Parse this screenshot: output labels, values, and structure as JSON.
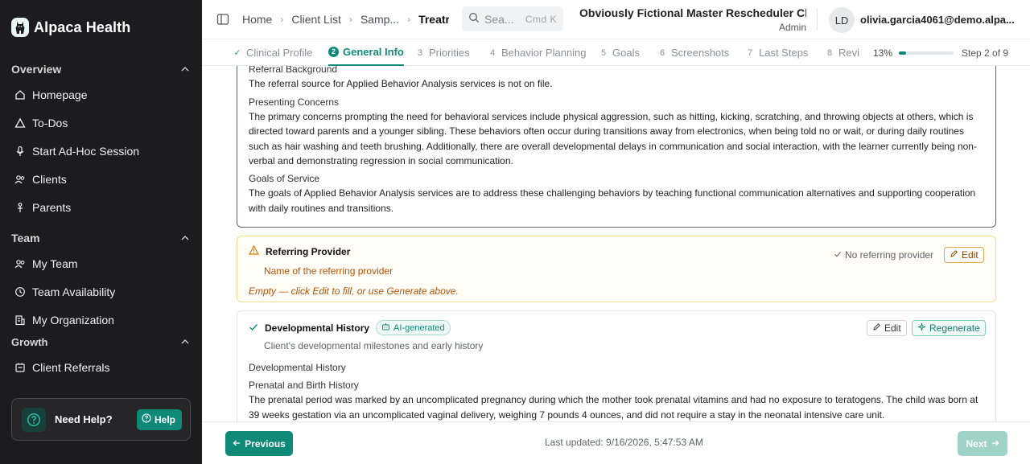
{
  "app": {
    "name": "Alpaca Health"
  },
  "sidebar": {
    "groups": [
      {
        "label": "Overview",
        "items": [
          {
            "label": "Homepage",
            "icon": "home-icon"
          },
          {
            "label": "To-Dos",
            "icon": "warning-icon"
          },
          {
            "label": "Start Ad-Hoc Session",
            "icon": "microphone-icon"
          },
          {
            "label": "Clients",
            "icon": "users-icon"
          },
          {
            "label": "Parents",
            "icon": "person-icon"
          }
        ]
      },
      {
        "label": "Team",
        "items": [
          {
            "label": "My Team",
            "icon": "users-icon"
          },
          {
            "label": "Team Availability",
            "icon": "clock-icon"
          },
          {
            "label": "My Organization",
            "icon": "building-icon"
          }
        ]
      },
      {
        "label": "Growth",
        "items": [
          {
            "label": "Client Referrals",
            "icon": "referral-icon"
          }
        ]
      }
    ],
    "help": {
      "title": "Need Help?",
      "button": "Help"
    }
  },
  "topbar": {
    "breadcrumbs": [
      "Home",
      "Client List",
      "Samp...",
      "Treatr"
    ],
    "search": {
      "placeholder": "Sea...",
      "shortcut": "Cmd K"
    },
    "org": {
      "name": "Obviously Fictional Master Rescheduler Cli...",
      "role": "Admin"
    },
    "user": {
      "initials": "LD",
      "email": "olivia.garcia4061@demo.alpa..."
    }
  },
  "steps": {
    "items": [
      {
        "num": "✓",
        "label": "Clinical Profile",
        "state": "done"
      },
      {
        "num": "2",
        "label": "General Info",
        "state": "active"
      },
      {
        "num": "3",
        "label": "Priorities",
        "state": "pending"
      },
      {
        "num": "4",
        "label": "Behavior Planning",
        "state": "pending"
      },
      {
        "num": "5",
        "label": "Goals",
        "state": "pending"
      },
      {
        "num": "6",
        "label": "Screenshots",
        "state": "pending"
      },
      {
        "num": "7",
        "label": "Last Steps",
        "state": "pending"
      },
      {
        "num": "8",
        "label": "Revi",
        "state": "pending"
      }
    ],
    "progress_text": "13%",
    "progress_fraction": 0.13,
    "step_of": "Step 2 of 9"
  },
  "content": {
    "top_card": {
      "sections": [
        {
          "heading": "Referral Background",
          "text": "The referral source for Applied Behavior Analysis services is not on file."
        },
        {
          "heading": "Presenting Concerns",
          "text": "The primary concerns prompting the need for behavioral services include physical aggression, such as hitting, kicking, scratching, and throwing objects at others, which is directed toward parents and a younger sibling. These behaviors often occur during transitions away from electronics, when being told no or wait, or during daily routines such as hair washing and teeth brushing. Additionally, there are overall developmental delays in communication and social interaction, with the learner currently being non-verbal and demonstrating regression in social communication."
        },
        {
          "heading": "Goals of Service",
          "text": "The goals of Applied Behavior Analysis services are to address these challenging behaviors by teaching functional communication alternatives and supporting cooperation with daily routines and transitions."
        }
      ]
    },
    "referring_provider": {
      "title": "Referring Provider",
      "subtitle": "Name of the referring provider",
      "status": "No referring provider",
      "edit_label": "Edit",
      "empty_message": "Empty — click Edit to fill, or use Generate above."
    },
    "developmental_history": {
      "title": "Developmental History",
      "badge": "AI-generated",
      "subtitle": "Client's developmental milestones and early history",
      "edit_label": "Edit",
      "regenerate_label": "Regenerate",
      "heading": "Developmental History",
      "subheading": "Prenatal and Birth History",
      "text": "The prenatal period was marked by an uncomplicated pregnancy during which the mother took prenatal vitamins and had no exposure to teratogens. The child was born at 39 weeks gestation via an uncomplicated vaginal delivery, weighing 7 pounds 4 ounces, and did not require a stay in the neonatal intensive care unit."
    }
  },
  "footer": {
    "previous_label": "Previous",
    "last_updated": "Last updated: 9/16/2026, 5:47:53 AM",
    "next_label": "Next"
  },
  "colors": {
    "accent": "#0f8a78",
    "sidebar_bg": "#1c1c1e",
    "warning_border": "#f4dc8a",
    "warning_text": "#b45309"
  }
}
